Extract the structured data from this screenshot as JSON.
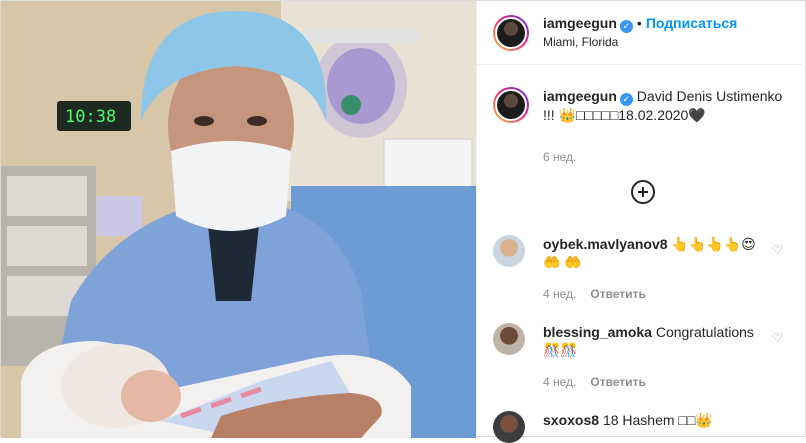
{
  "post": {
    "username": "iamgeegun",
    "follow_label": "Подписаться",
    "location": "Miami, Florida",
    "caption": "David Denis Ustimenko !!! 👑□□□□□18.02.2020🖤",
    "time_ago": "6 нед.",
    "photo_clock": "10:38"
  },
  "comments": [
    {
      "username": "oybek.mavlyanov8",
      "text": "👆👆👆👆😍🤲 🤲",
      "time": "4 нед.",
      "reply_label": "Ответить"
    },
    {
      "username": "blessing_amoka",
      "text": "Congratulations 🎊🎊",
      "time": "4 нед.",
      "reply_label": "Ответить"
    },
    {
      "username": "sxoxos8",
      "text": "18 Hashem □□👑",
      "time": "",
      "reply_label": ""
    }
  ]
}
